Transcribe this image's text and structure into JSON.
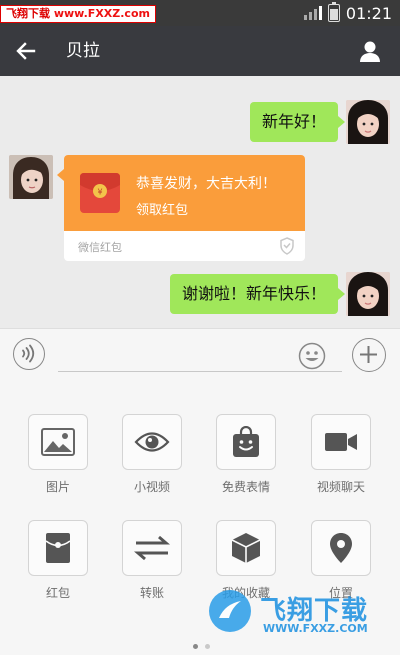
{
  "status_bar": {
    "time": "01:21"
  },
  "watermark_top": {
    "name": "飞翔下载",
    "site": "www.FXXZ.com"
  },
  "header": {
    "title": "贝拉"
  },
  "messages": [
    {
      "side": "right",
      "text": "新年好！"
    },
    {
      "side": "left",
      "type": "red-packet",
      "title": "恭喜发财，大吉大利！",
      "action": "领取红包",
      "footer": "微信红包"
    },
    {
      "side": "right",
      "text": "谢谢啦！新年快乐！"
    }
  ],
  "input": {
    "value": "",
    "placeholder": ""
  },
  "tools": [
    {
      "icon": "image-icon",
      "label": "图片"
    },
    {
      "icon": "eye-icon",
      "label": "小视频"
    },
    {
      "icon": "emoji-bag-icon",
      "label": "免费表情"
    },
    {
      "icon": "video-camera-icon",
      "label": "视频聊天"
    },
    {
      "icon": "red-envelope-icon",
      "label": "红包"
    },
    {
      "icon": "transfer-icon",
      "label": "转账"
    },
    {
      "icon": "box-icon",
      "label": "我的收藏"
    },
    {
      "icon": "location-pin-icon",
      "label": "位置"
    }
  ],
  "pager": {
    "pages": 2,
    "current": 1
  },
  "watermark_bottom": {
    "name": "飞翔下载",
    "url": "WWW.FXXZ.COM"
  },
  "colors": {
    "titlebar": "#393a3f",
    "bubble_green": "#a0e75a",
    "red_packet": "#fa9d3b"
  }
}
